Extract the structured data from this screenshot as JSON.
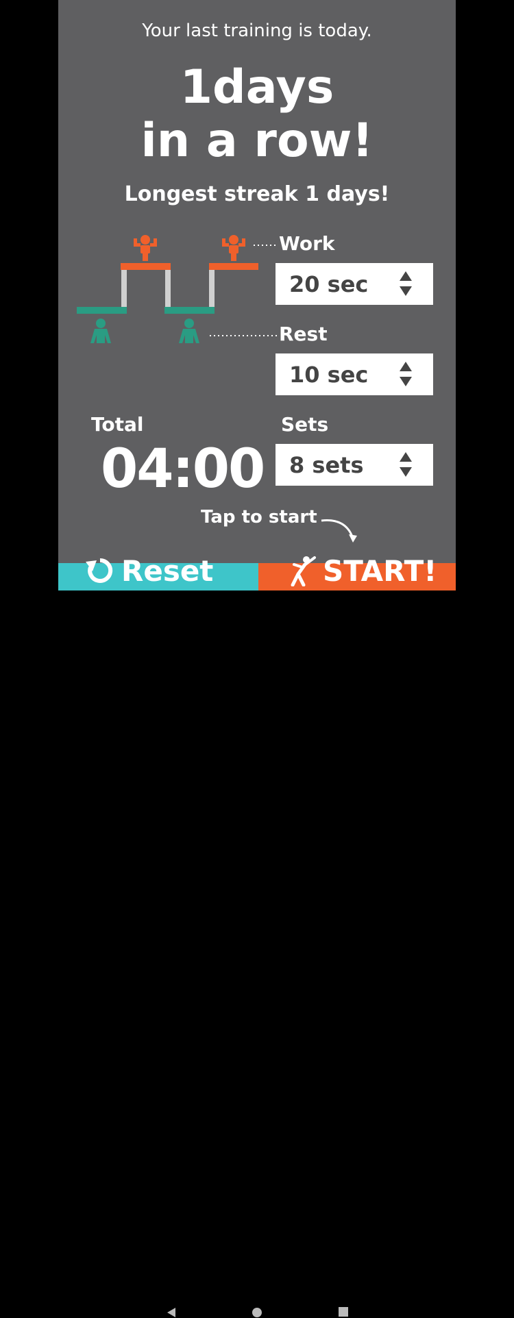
{
  "header": {
    "last_training": "Your last training is today.",
    "streak_line1": "1days",
    "streak_line2": "in a row!",
    "longest_streak": "Longest streak 1 days!"
  },
  "settings": {
    "work_label": "Work",
    "work_value": "20 sec",
    "rest_label": "Rest",
    "rest_value": "10 sec",
    "sets_label": "Sets",
    "sets_value": "8 sets"
  },
  "total": {
    "label": "Total",
    "time": "04:00"
  },
  "hint": {
    "tap_to_start": "Tap to start"
  },
  "buttons": {
    "reset_label": "Reset",
    "start_label": "START!"
  },
  "colors": {
    "background": "#5f5f61",
    "work_accent": "#f0602b",
    "rest_accent": "#2a9c83",
    "reset_button": "#3ec5c9",
    "start_button": "#f0602b"
  },
  "icons": {
    "work": "flexing-person-icon",
    "rest": "standing-person-icon",
    "reset": "reset-icon",
    "start": "stretching-person-icon",
    "stepper": "up-down-arrows-icon"
  }
}
